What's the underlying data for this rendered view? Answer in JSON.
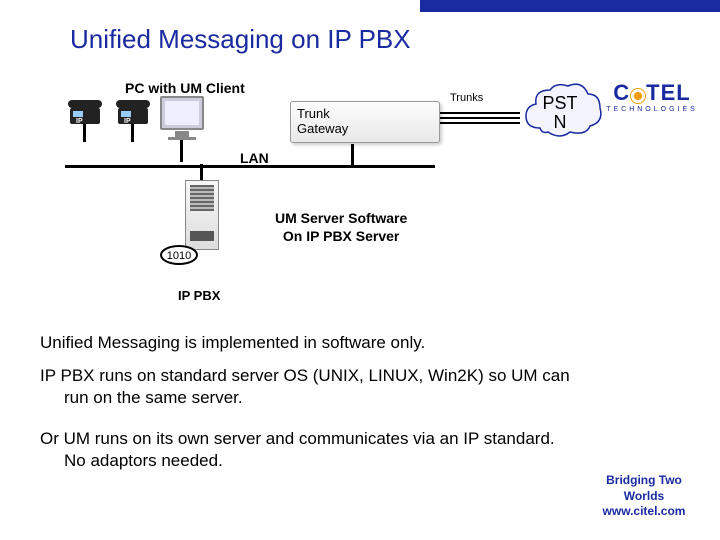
{
  "title": "Unified Messaging on IP PBX",
  "diagram": {
    "pc_label": "PC with UM Client",
    "phone_badge": "IP",
    "lan_label": "LAN",
    "trunk_gateway_label": "Trunk\nGateway",
    "trunks_label": "Trunks",
    "cloud_label": "PST\nN",
    "server_tag": "1010",
    "ippbx_label": "IP PBX",
    "um_server_label": "UM Server Software\nOn IP PBX Server"
  },
  "body": {
    "p1": "Unified Messaging is implemented in software only.",
    "p2": "IP PBX runs on standard server OS (UNIX, LINUX, Win2K) so UM can run on the same server.",
    "p3": "Or UM runs on its own server and communicates via an IP standard.  No adaptors needed."
  },
  "brand": {
    "name_left": "C",
    "name_right": "TEL",
    "sub": "TECHNOLOGIES",
    "footer_l1": "Bridging Two",
    "footer_l2": "Worlds",
    "footer_l3": "www.citel.com"
  }
}
